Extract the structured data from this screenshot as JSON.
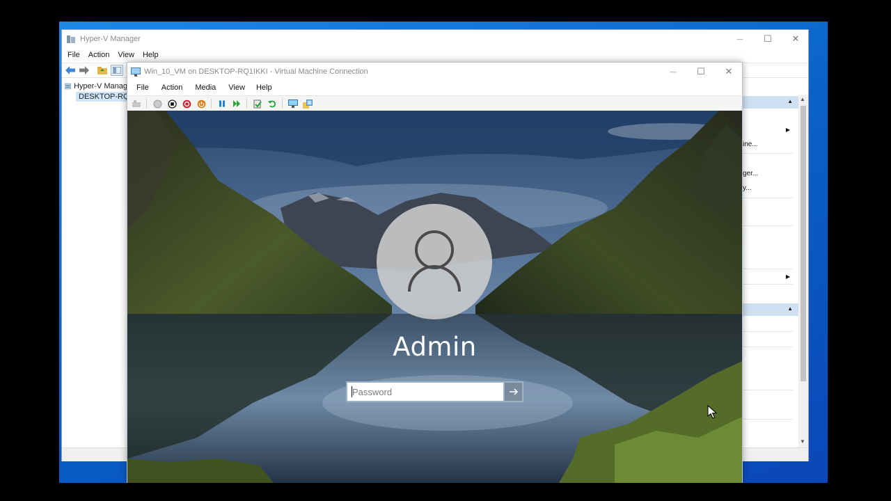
{
  "hyperv": {
    "title": "Hyper-V Manager",
    "menu": [
      "File",
      "Action",
      "View",
      "Help"
    ],
    "caption": {
      "minimize": "—",
      "maximize": "☐",
      "close": "✕"
    },
    "tree": {
      "root": "Hyper-V Manag",
      "host": "DESKTOP-RQ"
    },
    "actions": {
      "items": [
        "ine...",
        "ger...",
        "y..."
      ]
    }
  },
  "vm_connection": {
    "title": "Win_10_VM on DESKTOP-RQ1IKKI - Virtual Machine Connection",
    "menu": [
      "File",
      "Action",
      "Media",
      "View",
      "Help"
    ],
    "caption": {
      "minimize": "—",
      "maximize": "☐",
      "close": "✕"
    },
    "toolbar_icons": [
      "ctrl-alt-del-icon",
      "start-icon",
      "turn-off-icon",
      "shutdown-icon",
      "save-icon",
      "pause-icon",
      "resume-icon",
      "checkpoint-icon",
      "revert-icon",
      "enhanced-session-icon",
      "share-icon"
    ]
  },
  "lock_screen": {
    "username": "Admin",
    "password_placeholder": "Password"
  },
  "colors": {
    "desktop_blue": "#1e88e5",
    "action_header": "#cfe0f3",
    "tree_selection": "#cfe5f9"
  }
}
